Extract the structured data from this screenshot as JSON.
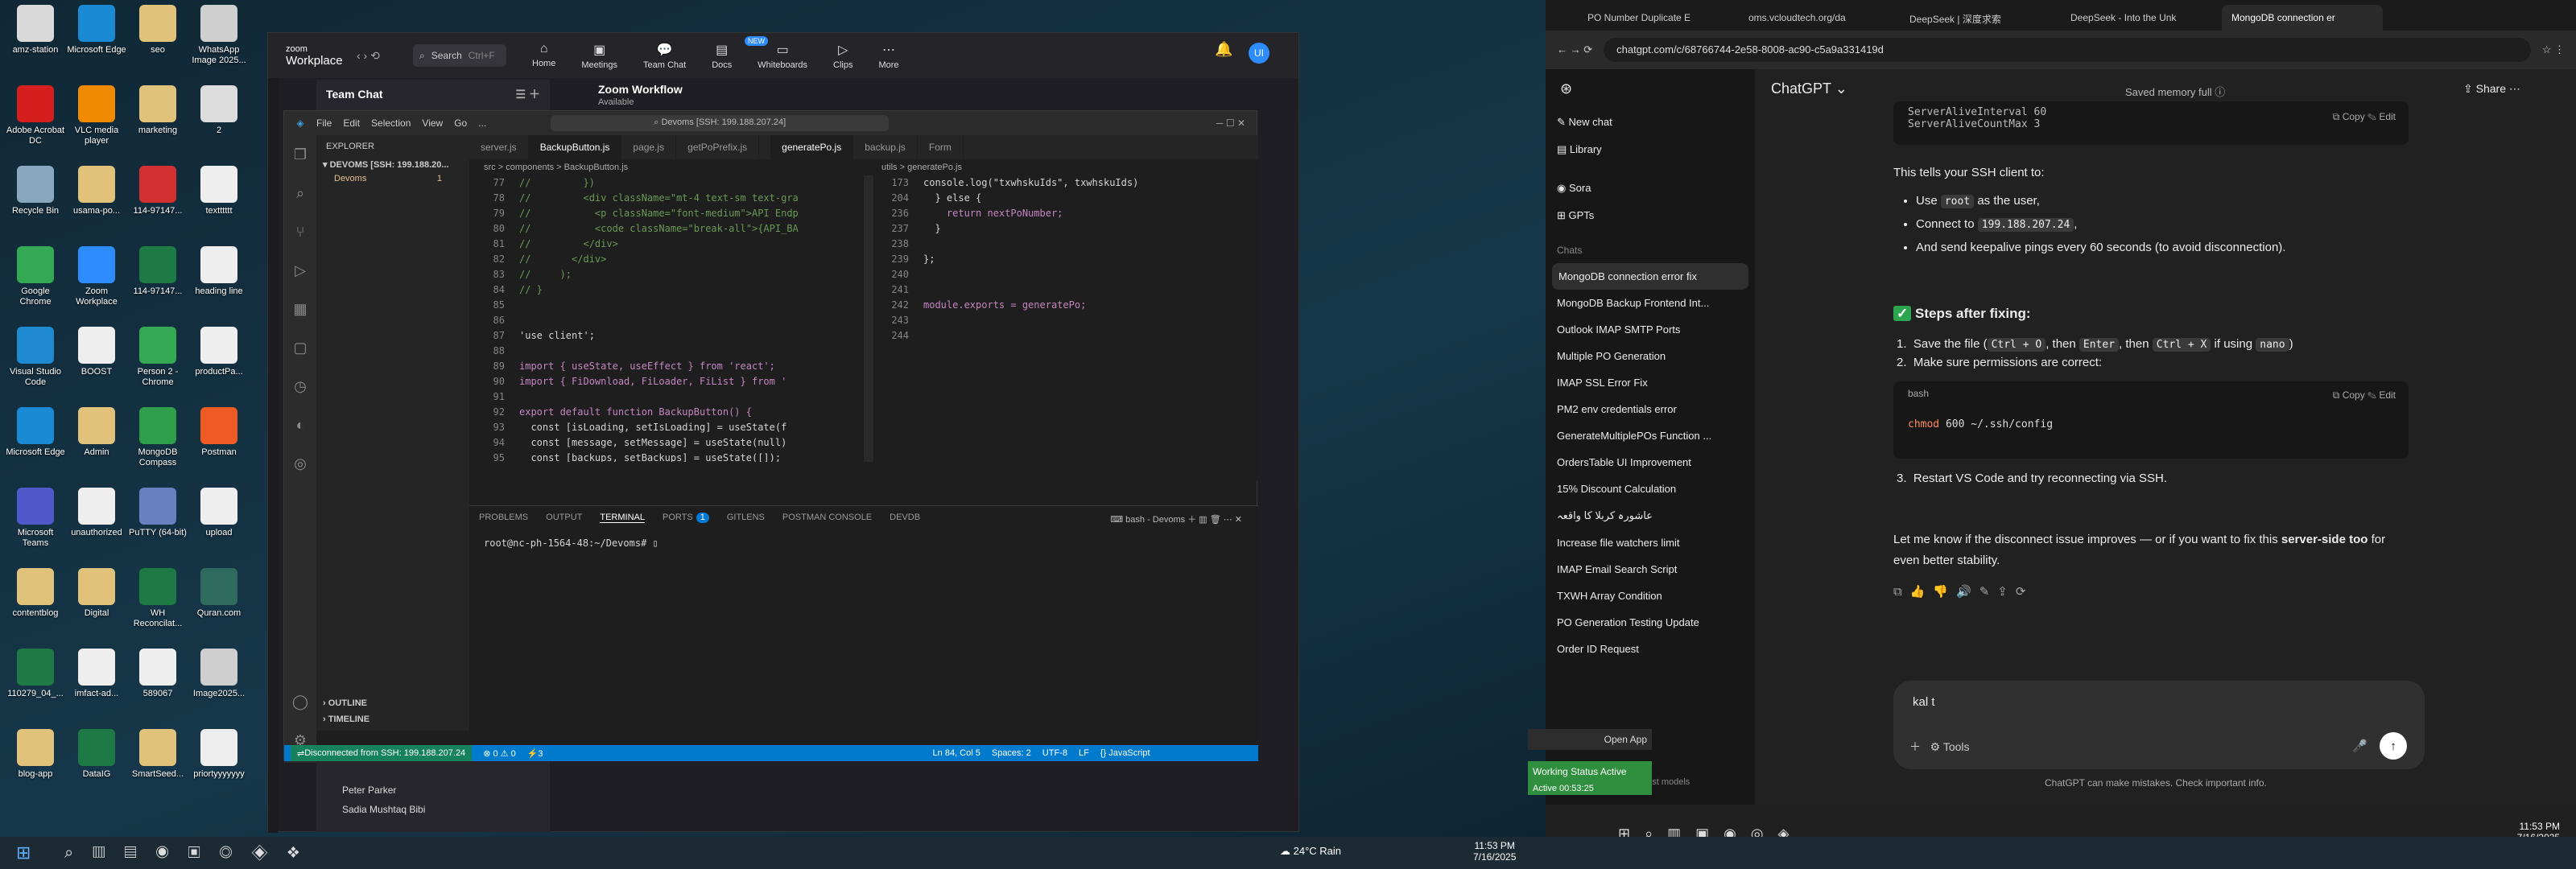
{
  "desktop": {
    "icons": [
      {
        "label": "amz-station",
        "color": "#d9d9d9"
      },
      {
        "label": "Microsoft Edge",
        "color": "#1a8ad4"
      },
      {
        "label": "seo",
        "color": "#e0c27a"
      },
      {
        "label": "WhatsApp Image 2025...",
        "color": "#cfcfcf"
      },
      {
        "label": "Adobe Acrobat DC",
        "color": "#d51f1f"
      },
      {
        "label": "VLC media player",
        "color": "#f08a00"
      },
      {
        "label": "marketing",
        "color": "#e0c27a"
      },
      {
        "label": "2",
        "color": "#dddddd"
      },
      {
        "label": "Recycle Bin",
        "color": "#8aa7c0"
      },
      {
        "label": "usama-po...",
        "color": "#e0c27a"
      },
      {
        "label": "114-97147...",
        "color": "#d03030"
      },
      {
        "label": "textttttt",
        "color": "#eeeeee"
      },
      {
        "label": "Google Chrome",
        "color": "#34a853"
      },
      {
        "label": "Zoom Workplace",
        "color": "#2d8cff"
      },
      {
        "label": "114-97147...",
        "color": "#1d7a45"
      },
      {
        "label": "heading line",
        "color": "#eeeeee"
      },
      {
        "label": "Visual Studio Code",
        "color": "#1f8ad2"
      },
      {
        "label": "BOOST",
        "color": "#eeeeee"
      },
      {
        "label": "Person 2 - Chrome",
        "color": "#34a853"
      },
      {
        "label": "productPa...",
        "color": "#eeeeee"
      },
      {
        "label": "Microsoft Edge",
        "color": "#1a8ad4"
      },
      {
        "label": "Admin",
        "color": "#e0c27a"
      },
      {
        "label": "MongoDB Compass",
        "color": "#2f9e4a"
      },
      {
        "label": "Postman",
        "color": "#ef5b25"
      },
      {
        "label": "Microsoft Teams",
        "color": "#5059c9"
      },
      {
        "label": "unauthorized",
        "color": "#eeeeee"
      },
      {
        "label": "PuTTY (64-bit)",
        "color": "#6a7fbf"
      },
      {
        "label": "upload",
        "color": "#eeeeee"
      },
      {
        "label": "contentblog",
        "color": "#e0c27a"
      },
      {
        "label": "Digital",
        "color": "#e0c27a"
      },
      {
        "label": "WH Reconcilat...",
        "color": "#1d7a45"
      },
      {
        "label": "Quran.com",
        "color": "#2e6b5e"
      },
      {
        "label": "110279_04_...",
        "color": "#1d7a45"
      },
      {
        "label": "imfact-ad...",
        "color": "#eeeeee"
      },
      {
        "label": "589067",
        "color": "#eeeeee"
      },
      {
        "label": "Image2025...",
        "color": "#cfcfcf"
      },
      {
        "label": "blog-app",
        "color": "#e0c27a"
      },
      {
        "label": "DataIG",
        "color": "#1d7a45"
      },
      {
        "label": "SmartSeed...",
        "color": "#e0c27a"
      },
      {
        "label": "priortyyyyyyy",
        "color": "#eeeeee"
      }
    ]
  },
  "zoom": {
    "brand_top": "zoom",
    "brand_bottom": "Workplace",
    "search": "Search",
    "shortcut": "Ctrl+F",
    "tabs": [
      {
        "label": "Home",
        "icon": "⌂"
      },
      {
        "label": "Meetings",
        "icon": "▣"
      },
      {
        "label": "Team Chat",
        "icon": "💬"
      },
      {
        "label": "Docs",
        "icon": "▤"
      },
      {
        "label": "Whiteboards",
        "icon": "▭"
      },
      {
        "label": "Clips",
        "icon": "▷"
      },
      {
        "label": "More",
        "icon": "⋯"
      }
    ],
    "new_badge": "NEW",
    "avatar": "UI",
    "panel_title": "Team Chat",
    "chat_name": "Zoom Workflow",
    "chat_status": "Available",
    "contacts": [
      "Peter Parker",
      "Sadia Mushtaq Bibi"
    ]
  },
  "vscode": {
    "menu": [
      "File",
      "Edit",
      "Selection",
      "View",
      "Go",
      "..."
    ],
    "search": "Devoms [SSH: 199.188.207.24]",
    "explorer": "EXPLORER",
    "workspace": "DEVOMS [SSH: 199.188.20...",
    "folder": "Devoms",
    "folder_count": "1",
    "tabs": [
      {
        "label": "server.js"
      },
      {
        "label": "BackupButton.js"
      },
      {
        "label": "page.js"
      },
      {
        "label": "getPoPrefix.js"
      },
      {
        "label": "generatePo.js"
      },
      {
        "label": "backup.js"
      },
      {
        "label": "Form"
      }
    ],
    "breadcrumb": "src > components > BackupButton.js",
    "breadcrumb2": "utils > generatePo.js",
    "left_lines": [
      {
        "n": "77",
        "t": "//         })"
      },
      {
        "n": "78",
        "t": "//         <div className=\"mt-4 text-sm text-gra"
      },
      {
        "n": "79",
        "t": "//           <p className=\"font-medium\">API Endp"
      },
      {
        "n": "80",
        "t": "//           <code className=\"break-all\">{API_BA"
      },
      {
        "n": "81",
        "t": "//         </div>"
      },
      {
        "n": "82",
        "t": "//       </div>"
      },
      {
        "n": "83",
        "t": "//     );"
      },
      {
        "n": "84",
        "t": "// }"
      },
      {
        "n": "85",
        "t": ""
      },
      {
        "n": "86",
        "t": ""
      },
      {
        "n": "87",
        "t": "'use client';"
      },
      {
        "n": "88",
        "t": ""
      },
      {
        "n": "89",
        "t": "import { useState, useEffect } from 'react';"
      },
      {
        "n": "90",
        "t": "import { FiDownload, FiLoader, FiList } from '"
      },
      {
        "n": "91",
        "t": ""
      },
      {
        "n": "92",
        "t": "export default function BackupButton() {"
      },
      {
        "n": "93",
        "t": "  const [isLoading, setIsLoading] = useState(f"
      },
      {
        "n": "94",
        "t": "  const [message, setMessage] = useState(null)"
      },
      {
        "n": "95",
        "t": "  const [backups, setBackups] = useState([]);"
      }
    ],
    "right_lines": [
      {
        "n": "173",
        "t": "console.log(\"txwhskuIds\", txwhskuIds)"
      },
      {
        "n": "204",
        "t": "  } else {"
      },
      {
        "n": "236",
        "t": "    return nextPoNumber;"
      },
      {
        "n": "237",
        "t": "  }"
      },
      {
        "n": "238",
        "t": ""
      },
      {
        "n": "239",
        "t": "};"
      },
      {
        "n": "240",
        "t": ""
      },
      {
        "n": "241",
        "t": ""
      },
      {
        "n": "242",
        "t": "module.exports = generatePo;"
      },
      {
        "n": "243",
        "t": ""
      },
      {
        "n": "244",
        "t": ""
      }
    ],
    "panel_tabs": [
      "PROBLEMS",
      "OUTPUT",
      "TERMINAL",
      "PORTS",
      "GITLENS",
      "POSTMAN CONSOLE",
      "DEVDB"
    ],
    "ports_count": "1",
    "terminal_name": "bash - Devoms",
    "prompt": "root@nc-ph-1564-48:~/Devoms#",
    "outline": "OUTLINE",
    "timeline": "TIMELINE",
    "status": {
      "remote": "Disconnected from SSH: 199.188.207.24",
      "errors": "0",
      "warnings": "0",
      "ports": "3",
      "pos": "Ln 84, Col 5",
      "spaces": "Spaces: 2",
      "enc": "UTF-8",
      "eol": "LF",
      "lang": "{} JavaScript"
    }
  },
  "browser": {
    "tabs": [
      "PO Number Duplicate E",
      "oms.vcloudtech.org/da",
      "DeepSeek | 深度求索",
      "DeepSeek - Into the Unk",
      "MongoDB connection er"
    ],
    "url": "chatgpt.com/c/68766744-2e58-8008-ac90-c5a9a331419d"
  },
  "chatgpt": {
    "sidebar": {
      "new_chat": "New chat",
      "library": "Library",
      "sora": "Sora",
      "gpts": "GPTs",
      "chats_label": "Chats",
      "chats": [
        "MongoDB connection error fix",
        "MongoDB Backup Frontend Int...",
        "Outlook IMAP SMTP Ports",
        "Multiple PO Generation",
        "IMAP SSL Error Fix",
        "PM2 env credentials error",
        "GenerateMultiplePOs Function ...",
        "OrdersTable UI Improvement",
        "15% Discount Calculation",
        "عاشورہ کربلا کا واقعہ",
        "Increase file watchers limit",
        "IMAP Email Search Script",
        "TXWH Array Condition",
        "PO Generation Testing Update",
        "Order ID Request"
      ],
      "footer": "best models"
    },
    "model": "ChatGPT",
    "memory": "Saved memory full",
    "share": "Share",
    "code1": [
      "ServerAliveInterval 60",
      "ServerAliveCountMax 3"
    ],
    "copy": "Copy",
    "edit": "Edit",
    "p1": "This tells your SSH client to:",
    "b1": [
      "Use ",
      "root",
      " as the user,"
    ],
    "b2": [
      "Connect to ",
      "199.188.207.24",
      ","
    ],
    "b3": "And send keepalive pings every 60 seconds (to avoid disconnection).",
    "steps_title": "Steps after fixing:",
    "s1": [
      "Save the file (",
      "Ctrl + O",
      ", then ",
      "Enter",
      ", then ",
      "Ctrl + X",
      " if using ",
      "nano",
      ")"
    ],
    "s2": "Make sure permissions are correct:",
    "lang": "bash",
    "code2_cmd": "chmod",
    "code2_rest": " 600 ~/.ssh/config",
    "s3": "Restart VS Code and try reconnecting via SSH.",
    "p2a": "Let me know if the disconnect issue improves — or if you want to fix this ",
    "p2b": "server-side too",
    "p2c": " for even better stability.",
    "input": "kal t",
    "tools": "Tools",
    "disclaimer": "ChatGPT can make mistakes. Check important info."
  },
  "popup": {
    "open_app": "Open App",
    "working": "Working Status Active",
    "meta": "Active 00:53:25"
  },
  "taskbar": {
    "weather": "24°C  Rain",
    "time": "11:53 PM",
    "date": "7/16/2025",
    "time2": "11:53 PM",
    "date2": "7/16/2025"
  }
}
